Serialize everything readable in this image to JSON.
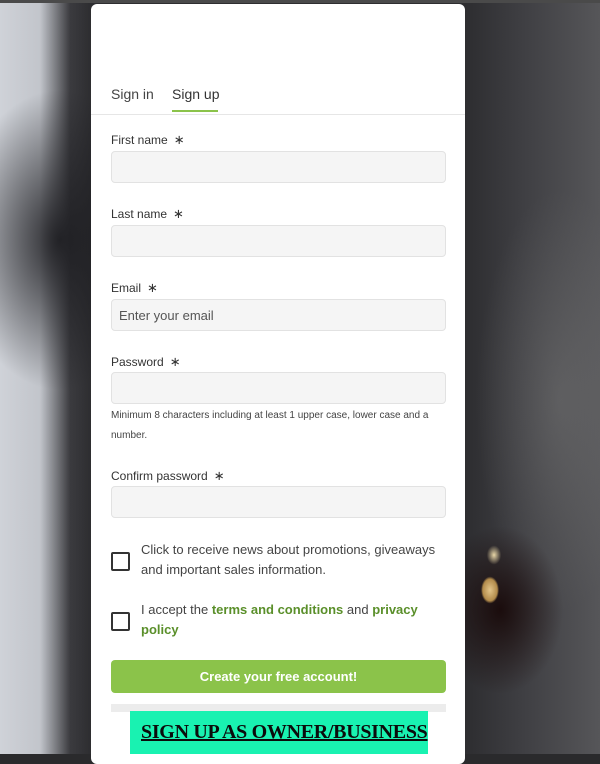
{
  "tabs": [
    {
      "label": "Sign in",
      "active": false
    },
    {
      "label": "Sign up",
      "active": true
    }
  ],
  "form": {
    "required_marker": "∗",
    "first_name": {
      "label": "First name",
      "value": "",
      "placeholder": ""
    },
    "last_name": {
      "label": "Last name",
      "value": "",
      "placeholder": ""
    },
    "email": {
      "label": "Email",
      "value": "",
      "placeholder": "Enter your email"
    },
    "password": {
      "label": "Password",
      "value": "",
      "placeholder": "",
      "hint": "Minimum 8 characters including at least 1 upper case, lower case and a number."
    },
    "confirm_password": {
      "label": "Confirm password",
      "value": "",
      "placeholder": ""
    },
    "newsletter": {
      "checked": false,
      "text": "Click to receive news about promotions, giveaways and important sales information."
    },
    "terms": {
      "checked": false,
      "prefix": "I accept the ",
      "terms_link": "terms and conditions",
      "middle": " and ",
      "privacy_link": "privacy policy"
    },
    "submit_label": "Create your free account!"
  },
  "business_cta": {
    "label": "SIGN UP AS OWNER/BUSINESS"
  },
  "colors": {
    "accent": "#8bc34a",
    "link": "#5a8f2a",
    "cta": "#19f2b1"
  }
}
